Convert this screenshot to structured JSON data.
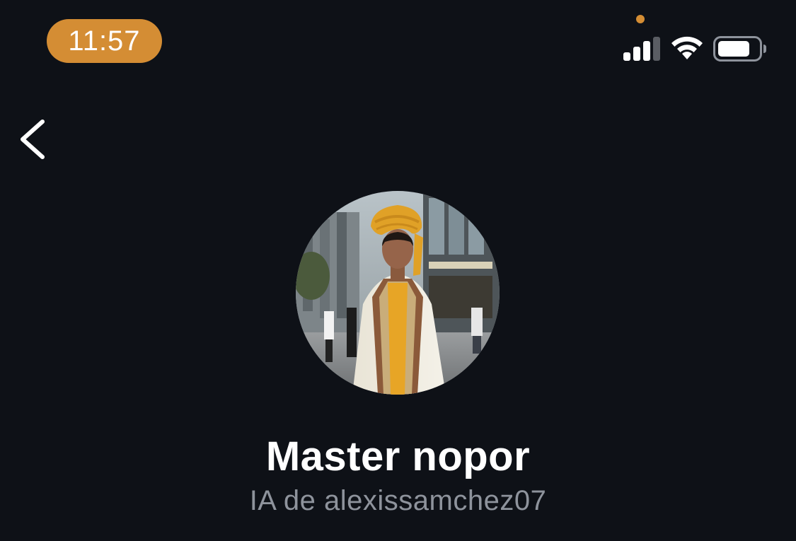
{
  "status_bar": {
    "time": "11:57",
    "accent_color": "#d48d34",
    "icons": [
      "cellular-signal-icon",
      "wifi-icon",
      "battery-icon"
    ]
  },
  "nav": {
    "back_icon": "chevron-left-icon"
  },
  "profile": {
    "name": "Master nopor",
    "subtitle": "IA de alexissamchez07",
    "avatar_description": "avatar-photo"
  },
  "colors": {
    "background": "#0e1117",
    "name_text": "#ffffff",
    "subtitle_text": "#8e939c"
  }
}
